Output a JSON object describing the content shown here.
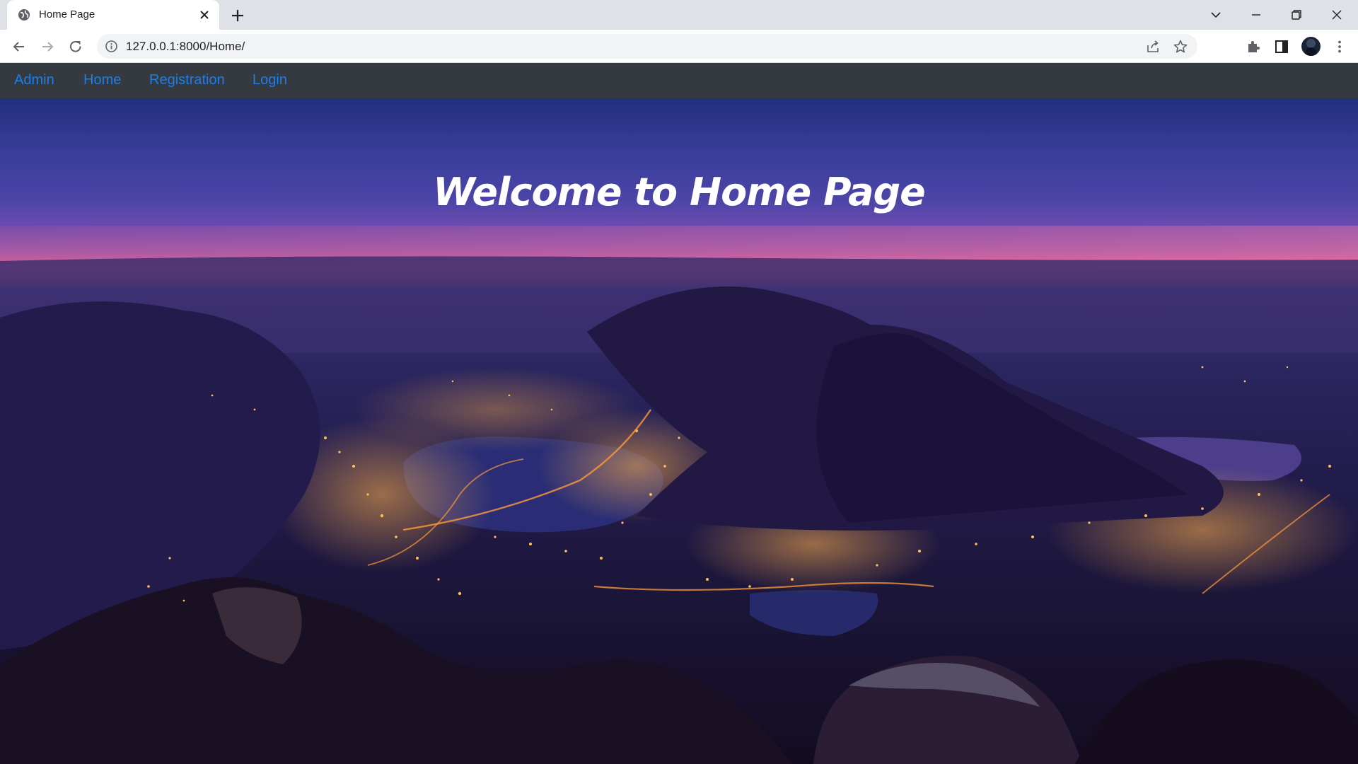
{
  "browser": {
    "tab_title": "Home Page",
    "url": "127.0.0.1:8000/Home/",
    "icons": {
      "favicon": "globe-icon",
      "tab_close": "close-icon",
      "new_tab": "plus-icon",
      "tab_search": "chevron-down-icon",
      "minimize": "minimize-icon",
      "restore": "restore-icon",
      "close_window": "close-icon",
      "back": "arrow-left-icon",
      "forward": "arrow-right-icon",
      "reload": "reload-icon",
      "site_info": "info-icon",
      "share": "share-icon",
      "bookmark": "star-icon",
      "extensions": "puzzle-icon",
      "side_panel": "side-panel-icon",
      "profile": "avatar",
      "menu": "kebab-menu-icon"
    }
  },
  "navbar": {
    "links": [
      {
        "label": "Admin"
      },
      {
        "label": "Home"
      },
      {
        "label": "Registration"
      },
      {
        "label": "Login"
      }
    ],
    "background": "#343a40",
    "link_color": "#1f7de6"
  },
  "hero": {
    "title": "Welcome to Home Page",
    "image": "night-city-lake-mountains-photo"
  }
}
